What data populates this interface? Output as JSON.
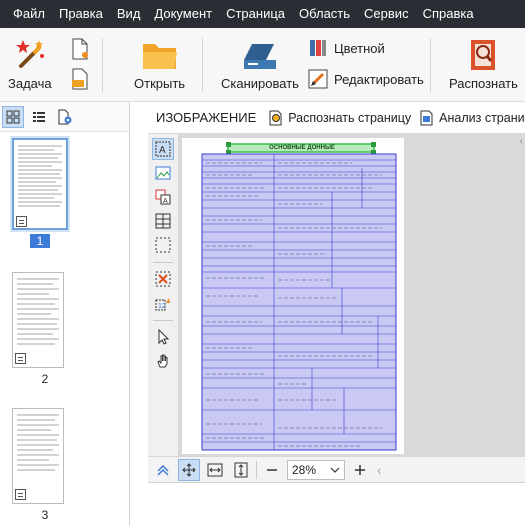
{
  "menu": [
    "Файл",
    "Правка",
    "Вид",
    "Документ",
    "Страница",
    "Область",
    "Сервис",
    "Справка"
  ],
  "toolbar": {
    "task_label": "Задача",
    "open_label": "Открыть",
    "scan_label": "Сканировать",
    "color_label": "Цветной",
    "edit_label": "Редактировать",
    "recognize_label": "Распознать"
  },
  "thumbnails": [
    {
      "number": "1",
      "selected": true
    },
    {
      "number": "2",
      "selected": false
    },
    {
      "number": "3",
      "selected": false
    }
  ],
  "image_panel": {
    "title": "ИЗОБРАЖЕНИЕ",
    "recognize_page_label": "Распознать страницу",
    "analyze_page_label": "Анализ страницы"
  },
  "document": {
    "heading": "ОСНОВНЫЕ ДОННЫЕ"
  },
  "zoom": {
    "value": "28%"
  },
  "colors": {
    "menubar": "#2a2d34",
    "selection": "#3d7bd9",
    "area_fill": "#c9c9f4",
    "area_border": "#3a3ad0",
    "title_area": "#39c04a"
  }
}
